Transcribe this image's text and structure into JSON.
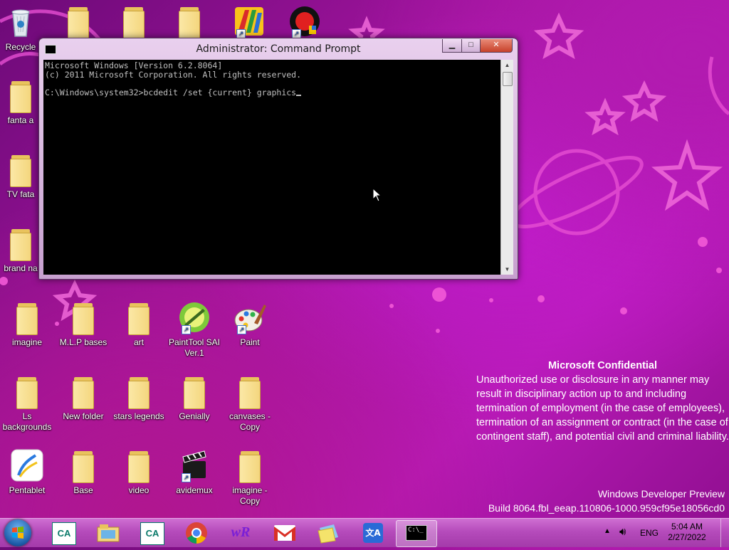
{
  "desktop": {
    "icons": [
      {
        "label": "Recycle",
        "type": "recycle"
      },
      {
        "label": "",
        "type": "folder"
      },
      {
        "label": "",
        "type": "folder"
      },
      {
        "label": "",
        "type": "folder"
      },
      {
        "label": "",
        "type": "app-avg"
      },
      {
        "label": "",
        "type": "app-record"
      },
      {
        "label": "fanta a",
        "type": "folder"
      },
      {
        "label": "TV fata",
        "type": "folder"
      },
      {
        "label": "brand na",
        "type": "folder"
      },
      {
        "label": "imagine",
        "type": "folder"
      },
      {
        "label": "M.L.P bases",
        "type": "folder"
      },
      {
        "label": "art",
        "type": "folder"
      },
      {
        "label": "PaintTool SAI Ver.1",
        "type": "app-sai"
      },
      {
        "label": "Paint",
        "type": "app-paint"
      },
      {
        "label": "Ls backgrounds",
        "type": "folder"
      },
      {
        "label": "New folder",
        "type": "folder"
      },
      {
        "label": "stars legends",
        "type": "folder"
      },
      {
        "label": "Genially",
        "type": "folder"
      },
      {
        "label": "canvases - Copy",
        "type": "folder"
      },
      {
        "label": "Pentablet",
        "type": "app-pentablet"
      },
      {
        "label": "Base",
        "type": "folder"
      },
      {
        "label": "video",
        "type": "folder"
      },
      {
        "label": "avidemux",
        "type": "app-avidemux"
      },
      {
        "label": "imagine - Copy",
        "type": "folder"
      }
    ]
  },
  "window": {
    "title": "Administrator: Command Prompt",
    "minimize": "▁",
    "maximize": "□",
    "close": "✕",
    "console_lines": [
      "Microsoft Windows [Version 6.2.8064]",
      "(c) 2011 Microsoft Corporation. All rights reserved.",
      "",
      "C:\\Windows\\system32>bcdedit /set {current} graphics"
    ]
  },
  "watermark": {
    "heading": "Microsoft Confidential",
    "body": "Unauthorized use or disclosure in any manner may result in disciplinary action up to and including termination of employment (in the case of employees), termination of an assignment or contract (in the case of contingent staff), and potential civil and criminal liability.",
    "product": "Windows Developer Preview",
    "build": "Build 8064.fbl_eeap.110806-1000.959cf95e18056cd0"
  },
  "taskbar": {
    "items": [
      {
        "name": "credit-agricole-icon",
        "glyph": "CA",
        "color": "#0a7a6a"
      },
      {
        "name": "file-explorer-icon",
        "glyph": "▤",
        "color": "#e0b64a"
      },
      {
        "name": "credit-agricole-icon-2",
        "glyph": "CA",
        "color": "#0a7a6a"
      },
      {
        "name": "chrome-icon",
        "glyph": "◉",
        "color": "#db4437"
      },
      {
        "name": "wr-icon",
        "glyph": "wR",
        "color": "#f2a900"
      },
      {
        "name": "gmail-icon",
        "glyph": "M",
        "color": "#d93025"
      },
      {
        "name": "sticky-notes-icon",
        "glyph": "▱",
        "color": "#f4e36b"
      },
      {
        "name": "language-icon",
        "glyph": "文A",
        "color": "#2a6ad6"
      },
      {
        "name": "command-prompt-icon",
        "glyph": "C:\\_",
        "color": "#000000"
      }
    ],
    "tray": {
      "language": "ENG",
      "time": "5:04 AM",
      "date": "2/27/2022"
    }
  },
  "colors": {
    "accent": "#b51cb3",
    "console_bg": "#000000",
    "console_text": "#c0c0c0"
  }
}
